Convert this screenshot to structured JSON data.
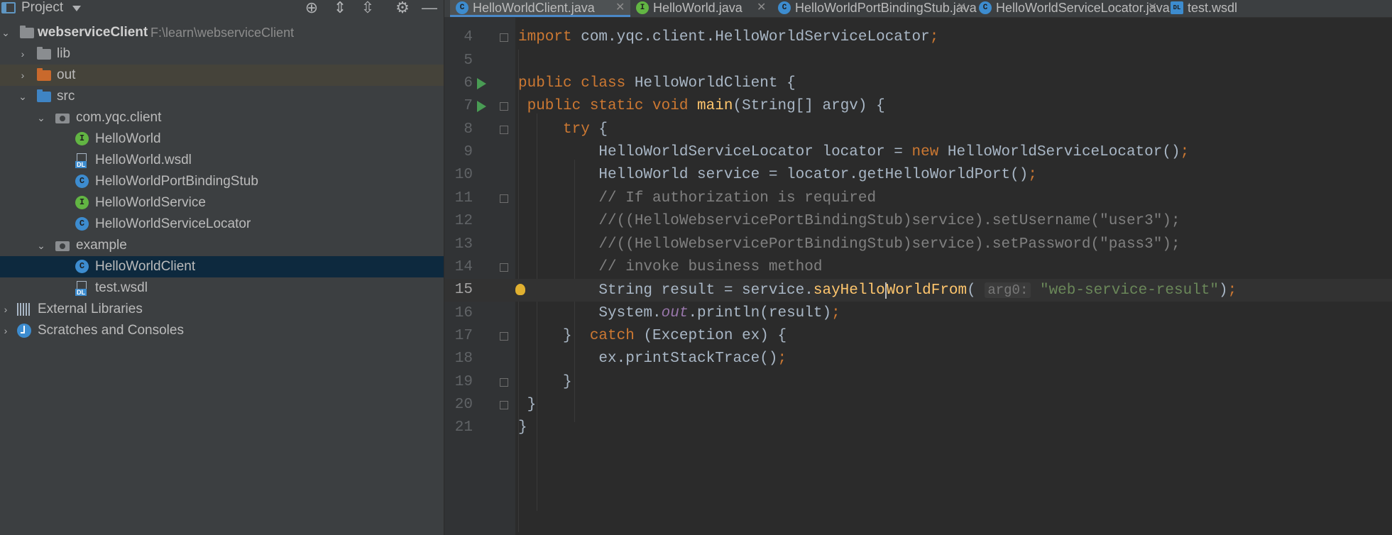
{
  "project_panel": {
    "title": "Project",
    "tree": [
      {
        "label": "webserviceClient",
        "path": "F:\\learn\\webserviceClient"
      },
      {
        "label": "lib"
      },
      {
        "label": "out"
      },
      {
        "label": "src"
      },
      {
        "label": "com.yqc.client"
      },
      {
        "label": "HelloWorld"
      },
      {
        "label": "HelloWorld.wsdl"
      },
      {
        "label": "HelloWorldPortBindingStub"
      },
      {
        "label": "HelloWorldService"
      },
      {
        "label": "HelloWorldServiceLocator"
      },
      {
        "label": "example"
      },
      {
        "label": "HelloWorldClient"
      },
      {
        "label": "test.wsdl"
      },
      {
        "label": "External Libraries"
      },
      {
        "label": "Scratches and Consoles"
      }
    ]
  },
  "tabs": [
    {
      "label": "HelloWorldClient.java",
      "icon": "C"
    },
    {
      "label": "HelloWorld.java",
      "icon": "I"
    },
    {
      "label": "HelloWorldPortBindingStub.java",
      "icon": "C"
    },
    {
      "label": "HelloWorldServiceLocator.java",
      "icon": "C"
    },
    {
      "label": "test.wsdl",
      "icon": "DL"
    }
  ],
  "editor": {
    "lines": [
      {
        "n": "4",
        "parts": [
          "import ",
          "com.yqc.client.HelloWorldServiceLocator",
          ";"
        ]
      },
      {
        "n": "5",
        "parts": []
      },
      {
        "n": "6",
        "parts": [
          "public class ",
          "HelloWorldClient {"
        ]
      },
      {
        "n": "7",
        "parts": [
          " public static void ",
          "main",
          "(String[] argv) {"
        ]
      },
      {
        "n": "8",
        "parts": [
          "     try ",
          "{"
        ]
      },
      {
        "n": "9",
        "parts": [
          "         HelloWorldServiceLocator locator = ",
          "new ",
          "HelloWorldServiceLocator()",
          ";"
        ]
      },
      {
        "n": "10",
        "parts": [
          "         HelloWorld service = locator.getHelloWorldPort()",
          ";"
        ]
      },
      {
        "n": "11",
        "parts": [
          "         // If authorization is required"
        ]
      },
      {
        "n": "12",
        "parts": [
          "         //((HelloWebservicePortBindingStub)service).setUsername(\"user3\");"
        ]
      },
      {
        "n": "13",
        "parts": [
          "         //((HelloWebservicePortBindingStub)service).setPassword(\"pass3\");"
        ]
      },
      {
        "n": "14",
        "parts": [
          "         // invoke business method"
        ]
      },
      {
        "n": "15",
        "parts": [
          "         String result = service.",
          "sayHello",
          "WorldFrom",
          "( ",
          "arg0:",
          " ",
          "\"web-service-result\"",
          ")",
          ";"
        ]
      },
      {
        "n": "16",
        "parts": [
          "         System.",
          "out",
          ".println(result)",
          ";"
        ]
      },
      {
        "n": "17",
        "parts": [
          "     }  ",
          "catch ",
          "(Exception ex) {"
        ]
      },
      {
        "n": "18",
        "parts": [
          "         ex.printStackTrace()",
          ";"
        ]
      },
      {
        "n": "19",
        "parts": [
          "     }"
        ]
      },
      {
        "n": "20",
        "parts": [
          " }"
        ]
      },
      {
        "n": "21",
        "parts": [
          "}"
        ]
      }
    ]
  }
}
